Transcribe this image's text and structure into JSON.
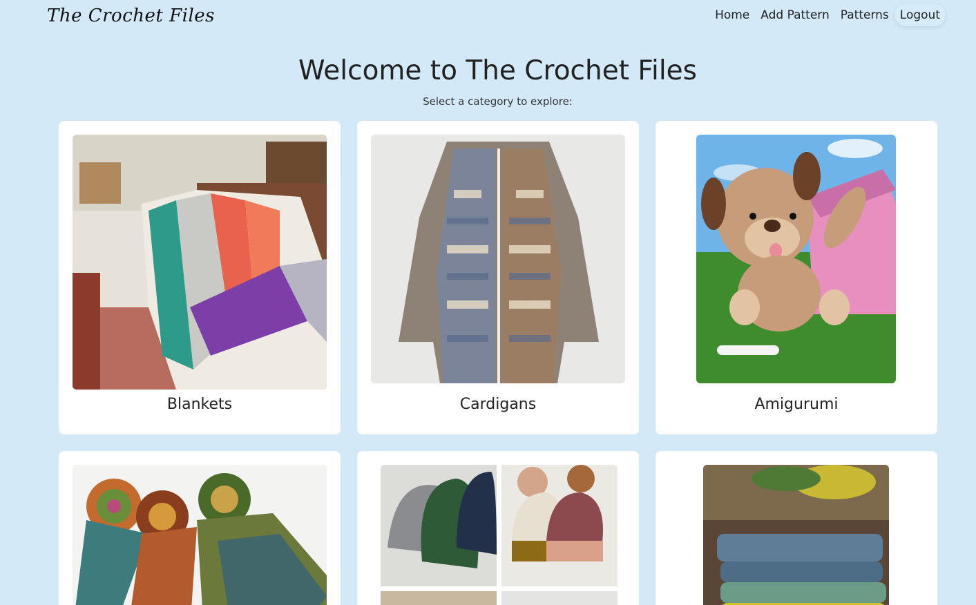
{
  "navbar": {
    "brand": "The Crochet Files",
    "links": {
      "home": "Home",
      "add_pattern": "Add Pattern",
      "patterns": "Patterns",
      "logout": "Logout"
    }
  },
  "hero": {
    "title": "Welcome to The Crochet Files",
    "subtitle": "Select a category to explore:"
  },
  "categories": [
    {
      "title": "Blankets"
    },
    {
      "title": "Cardigans"
    },
    {
      "title": "Amigurumi"
    },
    {
      "title": ""
    },
    {
      "title": ""
    },
    {
      "title": ""
    }
  ],
  "colors": {
    "background": "#d3e9f8",
    "card": "#ffffff",
    "text": "#222222"
  }
}
